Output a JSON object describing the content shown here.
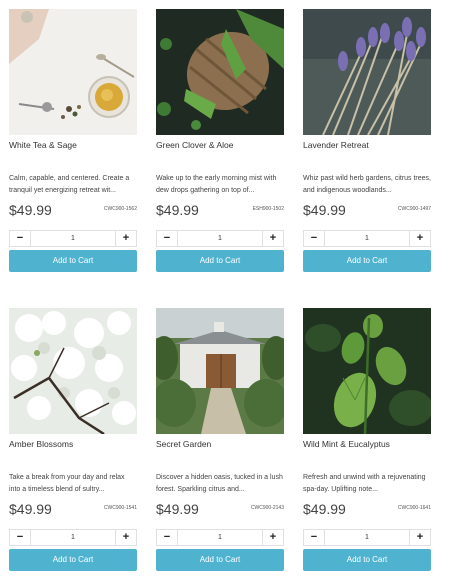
{
  "products": [
    {
      "name": "White Tea & Sage",
      "desc": "Calm, capable, and centered. Create a tranquil yet energizing retreat wit...",
      "price": "$49.99",
      "sku": "CWC900-1562",
      "qty": "1",
      "cart": "Add to Cart"
    },
    {
      "name": "Green Clover & Aloe",
      "desc": "Wake up to the early morning mist with dew drops gathering on top of...",
      "price": "$49.99",
      "sku": "ESH900-1502",
      "qty": "1",
      "cart": "Add to Cart"
    },
    {
      "name": "Lavender Retreat",
      "desc": "Whiz past wild herb gardens, citrus trees, and indigenous woodlands...",
      "price": "$49.99",
      "sku": "CWC900-1497",
      "qty": "1",
      "cart": "Add to Cart"
    },
    {
      "name": "Amber Blossoms",
      "desc": "Take a break from your day and relax into a timeless blend of sultry...",
      "price": "$49.99",
      "sku": "CWC900-1541",
      "qty": "1",
      "cart": "Add to Cart"
    },
    {
      "name": "Secret Garden",
      "desc": "Discover a hidden oasis, tucked in a lush forest. Sparkling citrus and...",
      "price": "$49.99",
      "sku": "CWC900-2143",
      "qty": "1",
      "cart": "Add to Cart"
    },
    {
      "name": "Wild Mint & Eucalyptus",
      "desc": "Refresh and unwind with a rejuvenating spa-day. Uplifting note...",
      "price": "$49.99",
      "sku": "CWC900-1641",
      "qty": "1",
      "cart": "Add to Cart"
    }
  ],
  "icons": {
    "minus": "−",
    "plus": "+"
  },
  "colors": {
    "accent": "#4fb3d0"
  }
}
